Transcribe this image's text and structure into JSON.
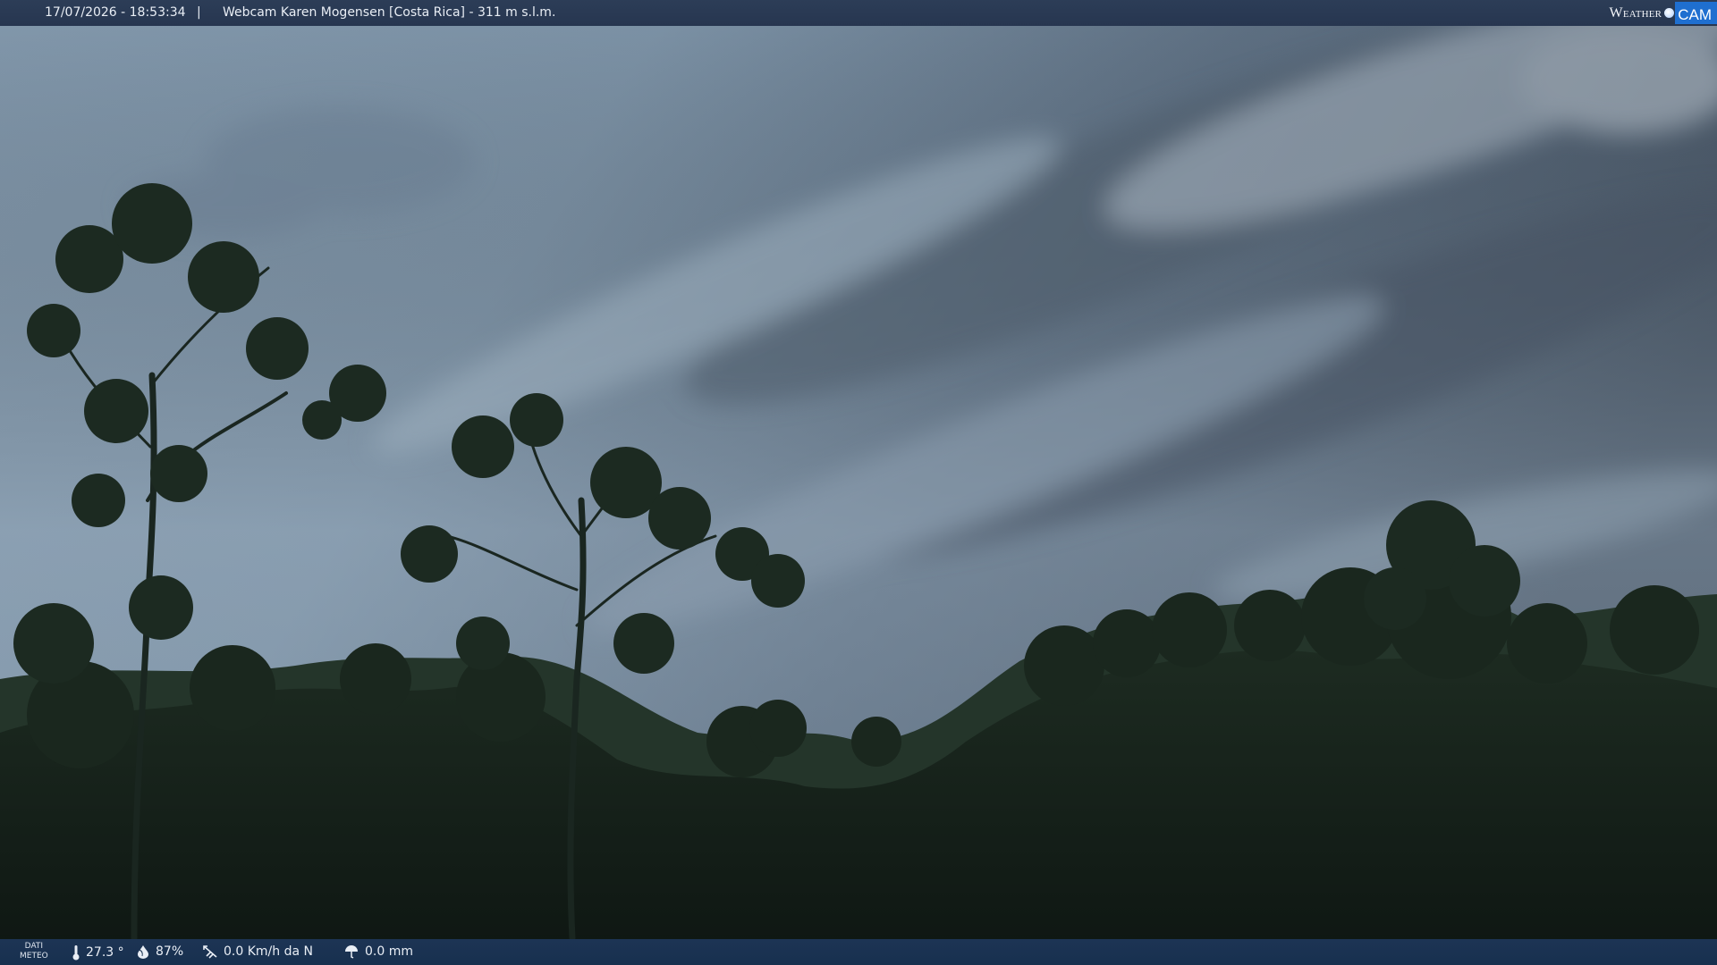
{
  "overlay": {
    "timestamp": "17/07/2026 - 18:53:34",
    "separator": "|",
    "location": "Webcam Karen Mogensen [Costa Rica] - 311 m s.l.m."
  },
  "brand": {
    "weather": "Weather",
    "cam": "CAM"
  },
  "meteo": {
    "label_line1": "DATI",
    "label_line2": "METEO",
    "temperature": "27.3 °",
    "humidity": "87%",
    "wind": "0.0 Km/h da N",
    "rain": "0.0 mm"
  },
  "colors": {
    "bar": "#273650",
    "brand_accent": "#1f6fd0"
  },
  "icons": {
    "temperature": "thermometer-icon",
    "humidity": "droplet-icon",
    "wind": "wind-vane-icon",
    "rain": "rain-gauge-icon"
  }
}
